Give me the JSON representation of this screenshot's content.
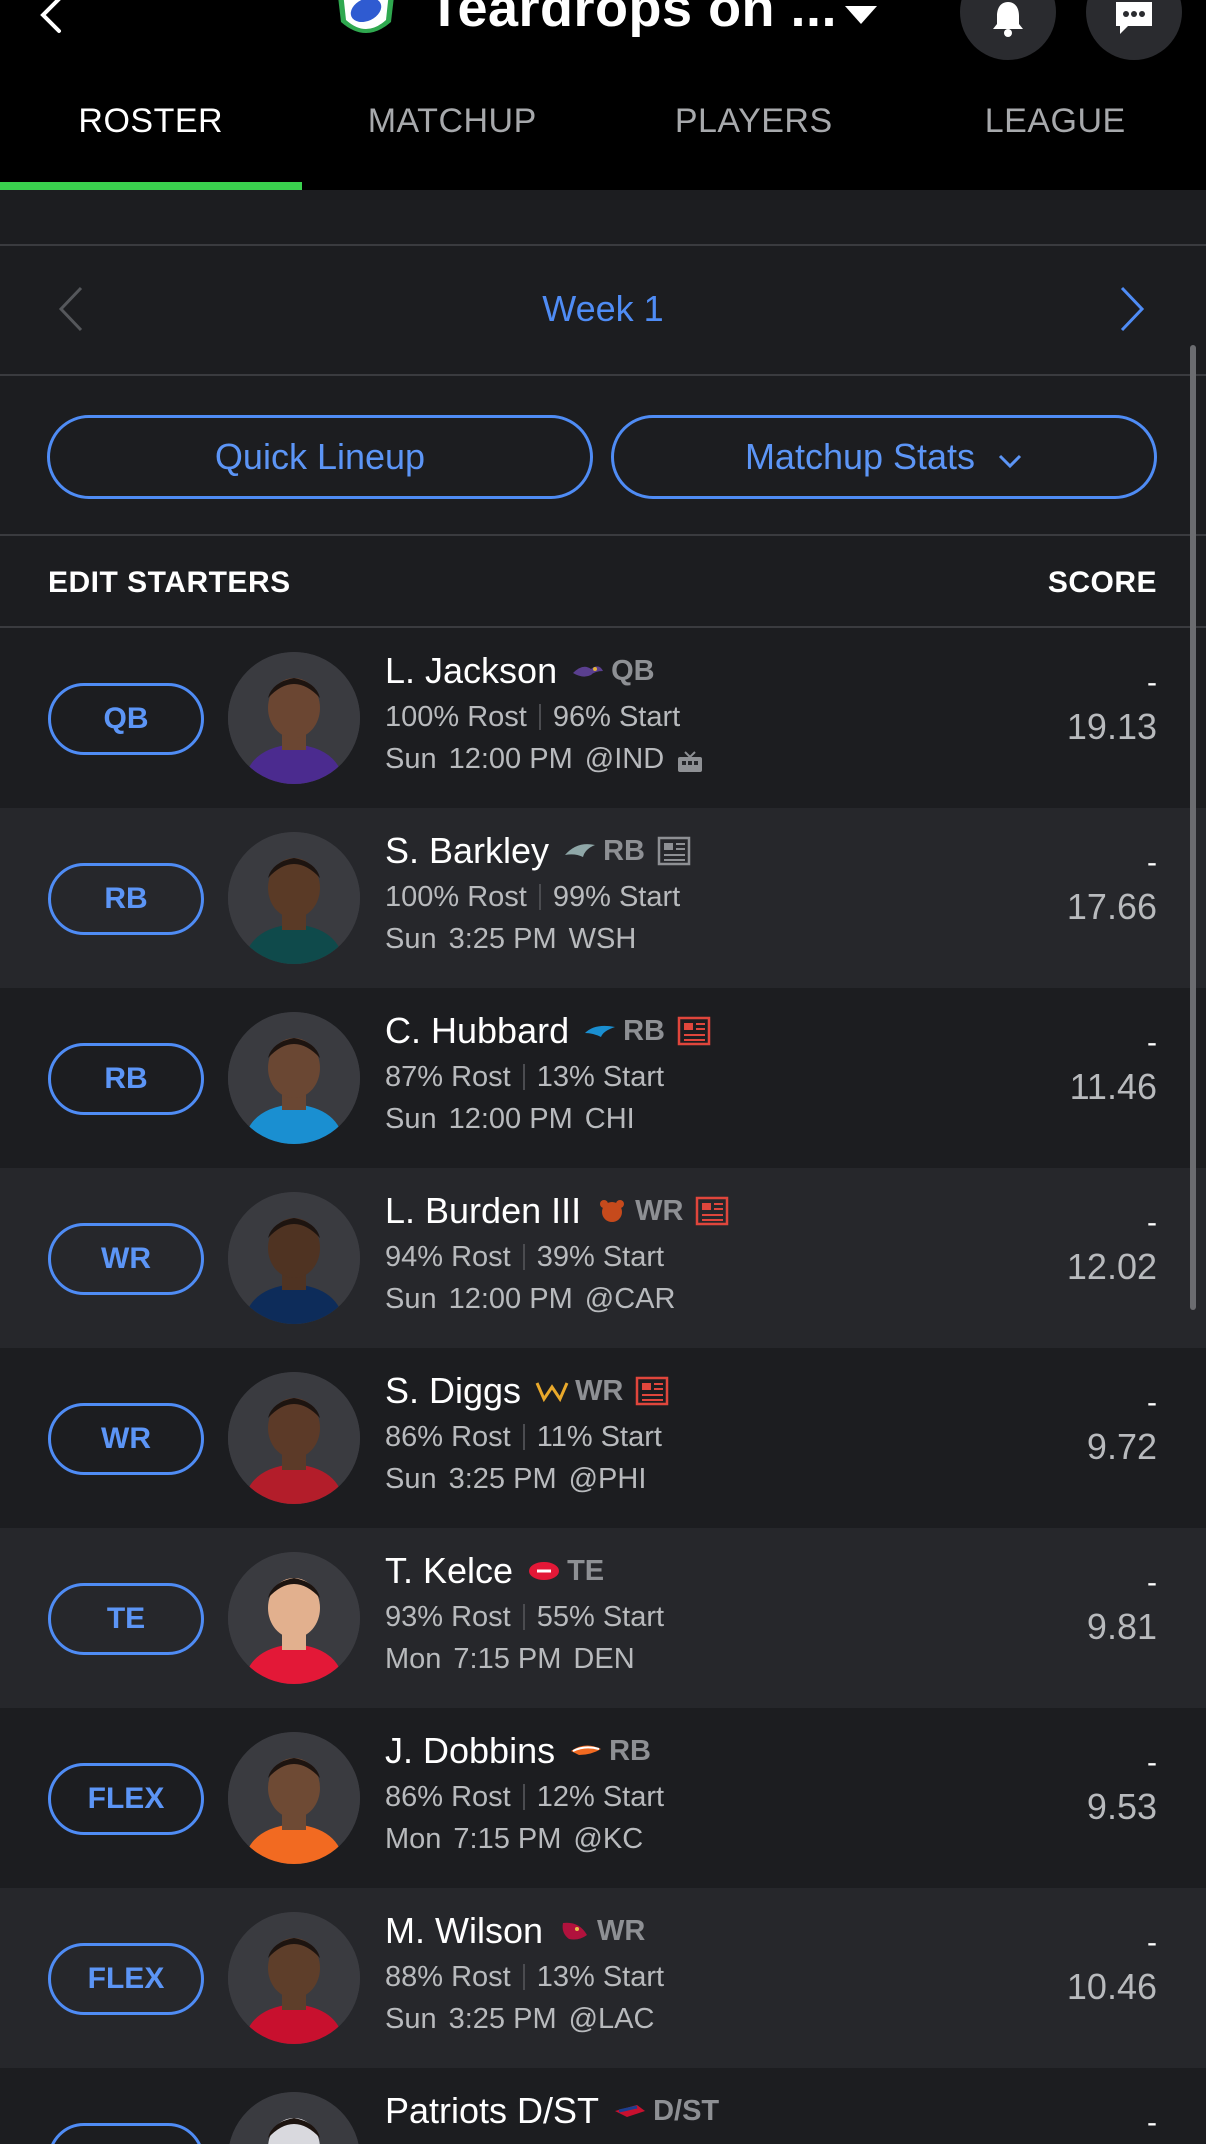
{
  "header": {
    "team_title": "Teardrops on ...",
    "back_icon": "chevron-left-icon",
    "bell_icon": "bell-icon",
    "chat_icon": "chat-icon"
  },
  "tabs": [
    {
      "label": "ROSTER",
      "active": true
    },
    {
      "label": "MATCHUP",
      "active": false
    },
    {
      "label": "PLAYERS",
      "active": false
    },
    {
      "label": "LEAGUE",
      "active": false
    }
  ],
  "week": {
    "label": "Week 1"
  },
  "actions": {
    "quick_lineup": "Quick Lineup",
    "matchup_stats": "Matchup Stats"
  },
  "section": {
    "title": "EDIT STARTERS",
    "score_label": "SCORE"
  },
  "colors": {
    "accent_blue": "#4f8cf5",
    "tab_indicator": "#3ad14e",
    "news_red": "#e0463c"
  },
  "players": [
    {
      "slot": "QB",
      "name": "L. Jackson",
      "team": "BAL",
      "pos": "QB",
      "news": false,
      "rost": "100% Rost",
      "start": "96% Start",
      "day": "Sun",
      "time": "12:00 PM",
      "opp": "@IND",
      "tv": true,
      "score": "-",
      "proj": "19.13"
    },
    {
      "slot": "RB",
      "name": "S. Barkley",
      "team": "PHI",
      "pos": "RB",
      "news": "gray",
      "rost": "100% Rost",
      "start": "99% Start",
      "day": "Sun",
      "time": "3:25 PM",
      "opp": "WSH",
      "tv": false,
      "score": "-",
      "proj": "17.66"
    },
    {
      "slot": "RB",
      "name": "C. Hubbard",
      "team": "CAR",
      "pos": "RB",
      "news": "red",
      "rost": "87% Rost",
      "start": "13% Start",
      "day": "Sun",
      "time": "12:00 PM",
      "opp": "CHI",
      "tv": false,
      "score": "-",
      "proj": "11.46"
    },
    {
      "slot": "WR",
      "name": "L. Burden III",
      "team": "CHI",
      "pos": "WR",
      "news": "red",
      "rost": "94% Rost",
      "start": "39% Start",
      "day": "Sun",
      "time": "12:00 PM",
      "opp": "@CAR",
      "tv": false,
      "score": "-",
      "proj": "12.02"
    },
    {
      "slot": "WR",
      "name": "S. Diggs",
      "team": "WSH",
      "pos": "WR",
      "news": "red",
      "rost": "86% Rost",
      "start": "11% Start",
      "day": "Sun",
      "time": "3:25 PM",
      "opp": "@PHI",
      "tv": false,
      "score": "-",
      "proj": "9.72"
    },
    {
      "slot": "TE",
      "name": "T. Kelce",
      "team": "KC",
      "pos": "TE",
      "news": false,
      "rost": "93% Rost",
      "start": "55% Start",
      "day": "Mon",
      "time": "7:15 PM",
      "opp": "DEN",
      "tv": false,
      "score": "-",
      "proj": "9.81"
    },
    {
      "slot": "FLEX",
      "name": "J. Dobbins",
      "team": "DEN",
      "pos": "RB",
      "news": false,
      "rost": "86% Rost",
      "start": "12% Start",
      "day": "Mon",
      "time": "7:15 PM",
      "opp": "@KC",
      "tv": false,
      "score": "-",
      "proj": "9.53"
    },
    {
      "slot": "FLEX",
      "name": "M. Wilson",
      "team": "ARI",
      "pos": "WR",
      "news": false,
      "rost": "88% Rost",
      "start": "13% Start",
      "day": "Sun",
      "time": "3:25 PM",
      "opp": "@LAC",
      "tv": false,
      "score": "-",
      "proj": "10.46"
    },
    {
      "slot": "",
      "name": "Patriots D/ST",
      "team": "NE",
      "pos": "D/ST",
      "news": false,
      "rost": "",
      "start": "",
      "day": "",
      "time": "",
      "opp": "",
      "tv": false,
      "score": "-",
      "proj": ""
    }
  ]
}
